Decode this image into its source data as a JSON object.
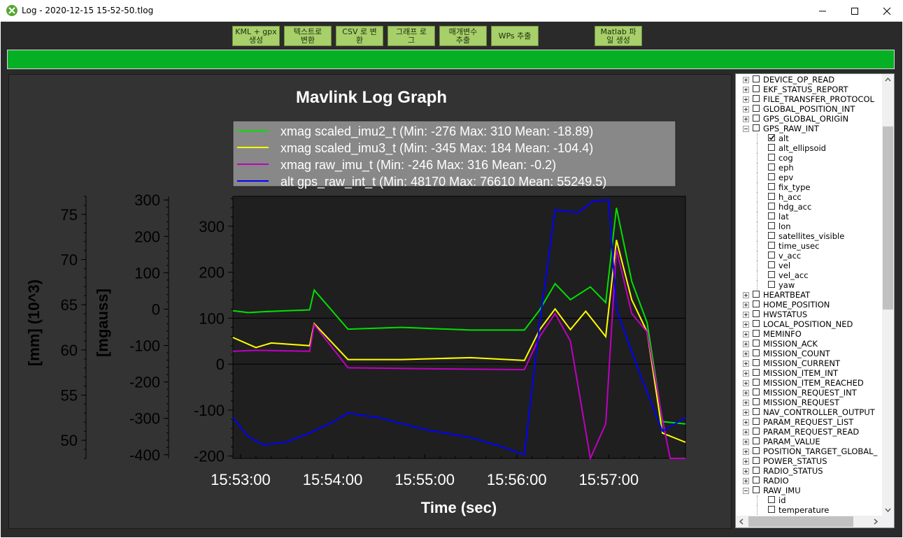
{
  "window": {
    "title": "Log - 2020-12-15 15-52-50.tlog",
    "controls": [
      "minimize-icon",
      "maximize-icon",
      "close-icon"
    ]
  },
  "toolbar": {
    "buttons": [
      {
        "line1": "KML + gpx",
        "line2": "생성"
      },
      {
        "line1": "텍스트로",
        "line2": "변환"
      },
      {
        "line1": "CSV 로 변",
        "line2": "환"
      },
      {
        "line1": "그래프 로",
        "line2": "그"
      },
      {
        "line1": "매개변수",
        "line2": "추출"
      },
      {
        "line1": "WPs 추출",
        "line2": ""
      },
      {
        "line1": "Matlab 파",
        "line2": "일 생성"
      }
    ]
  },
  "progress": {
    "value_percent": 100,
    "color": "#06b025"
  },
  "chart_data": {
    "type": "line",
    "title": "Mavlink Log Graph",
    "xlabel": "Time (sec)",
    "x_ticks": [
      "15:53:00",
      "15:54:00",
      "15:55:00",
      "15:56:00",
      "15:57:00"
    ],
    "x_range": [
      "15:52:55",
      "15:57:50"
    ],
    "y_axes": [
      {
        "label": "[mm] (10^3)",
        "ticks": [
          50,
          55,
          60,
          65,
          70,
          75
        ],
        "range": [
          48,
          77
        ]
      },
      {
        "label": "[mgauss]",
        "ticks": [
          -400,
          -300,
          -200,
          -100,
          0,
          100,
          200,
          300
        ],
        "range": [
          -410,
          310
        ]
      },
      {
        "label": "",
        "ticks": [
          -200,
          -100,
          0,
          100,
          200,
          300
        ],
        "range": [
          -205,
          365
        ]
      }
    ],
    "grid": true,
    "legend_position": "top-center",
    "series": [
      {
        "name": "xmag scaled_imu2_t (Min: -276 Max: 310 Mean: -18.89)",
        "color": "#00e000",
        "x": [
          "15:52:55",
          "15:53:05",
          "15:53:15",
          "15:53:30",
          "15:53:45",
          "15:53:48",
          "15:54:10",
          "15:54:45",
          "15:55:30",
          "15:56:05",
          "15:56:15",
          "15:56:25",
          "15:56:35",
          "15:56:48",
          "15:56:58",
          "15:57:05",
          "15:57:15",
          "15:57:25",
          "15:57:35",
          "15:57:50"
        ],
        "y": [
          116,
          112,
          114,
          116,
          118,
          161,
          76,
          80,
          74,
          74,
          118,
          175,
          140,
          168,
          134,
          340,
          180,
          90,
          -125,
          -130
        ]
      },
      {
        "name": "xmag scaled_imu3_t (Min: -345 Max: 184 Mean: -104.4)",
        "color": "#ffff00",
        "x": [
          "15:52:55",
          "15:53:10",
          "15:53:20",
          "15:53:45",
          "15:53:48",
          "15:54:10",
          "15:54:45",
          "15:55:30",
          "15:56:05",
          "15:56:15",
          "15:56:25",
          "15:56:35",
          "15:56:45",
          "15:56:58",
          "15:57:05",
          "15:57:15",
          "15:57:25",
          "15:57:35",
          "15:57:50"
        ],
        "y": [
          58,
          36,
          46,
          40,
          88,
          10,
          10,
          14,
          8,
          75,
          120,
          75,
          115,
          60,
          270,
          140,
          70,
          -150,
          -170
        ]
      },
      {
        "name": "xmag raw_imu_t (Min: -246 Max: 316 Mean: -0.2)",
        "color": "#c000c0",
        "x": [
          "15:52:55",
          "15:53:10",
          "15:53:45",
          "15:53:48",
          "15:54:10",
          "15:55:00",
          "15:56:05",
          "15:56:15",
          "15:56:25",
          "15:56:35",
          "15:56:48",
          "15:56:58",
          "15:57:05",
          "15:57:15",
          "15:57:25",
          "15:57:35",
          "15:57:40",
          "15:57:50"
        ],
        "y": [
          28,
          30,
          28,
          86,
          -8,
          -10,
          -12,
          60,
          110,
          50,
          -230,
          -130,
          250,
          110,
          70,
          -120,
          -245,
          -246
        ]
      },
      {
        "name": "alt gps_raw_int_t (Min: 48170 Max: 76610 Mean: 55249.5)",
        "color": "#0000ff",
        "x": [
          "15:52:55",
          "15:53:05",
          "15:53:15",
          "15:53:30",
          "15:53:45",
          "15:54:00",
          "15:54:10",
          "15:54:30",
          "15:55:00",
          "15:55:30",
          "15:55:50",
          "15:56:05",
          "15:56:15",
          "15:56:25",
          "15:56:40",
          "15:56:50",
          "15:57:00",
          "15:57:05",
          "15:57:20",
          "15:57:35",
          "15:57:50"
        ],
        "y": [
          52.5,
          50.4,
          49.5,
          49.8,
          50.8,
          52.0,
          53.0,
          52.5,
          51.2,
          50.3,
          49.3,
          48.4,
          63.0,
          75.5,
          75.2,
          76.5,
          76.6,
          64.5,
          57.5,
          51.0,
          52.5
        ]
      }
    ]
  },
  "tree": {
    "items": [
      {
        "label": "DEVICE_OP_READ",
        "level": 0,
        "expand": "+"
      },
      {
        "label": "EKF_STATUS_REPORT",
        "level": 0,
        "expand": "+"
      },
      {
        "label": "FILE_TRANSFER_PROTOCOL",
        "level": 0,
        "expand": "+"
      },
      {
        "label": "GLOBAL_POSITION_INT",
        "level": 0,
        "expand": "+"
      },
      {
        "label": "GPS_GLOBAL_ORIGIN",
        "level": 0,
        "expand": "+"
      },
      {
        "label": "GPS_RAW_INT",
        "level": 0,
        "expand": "-"
      },
      {
        "label": "alt",
        "level": 1,
        "checked": true
      },
      {
        "label": "alt_ellipsoid",
        "level": 1
      },
      {
        "label": "cog",
        "level": 1
      },
      {
        "label": "eph",
        "level": 1
      },
      {
        "label": "epv",
        "level": 1
      },
      {
        "label": "fix_type",
        "level": 1
      },
      {
        "label": "h_acc",
        "level": 1
      },
      {
        "label": "hdg_acc",
        "level": 1
      },
      {
        "label": "lat",
        "level": 1
      },
      {
        "label": "lon",
        "level": 1
      },
      {
        "label": "satellites_visible",
        "level": 1
      },
      {
        "label": "time_usec",
        "level": 1
      },
      {
        "label": "v_acc",
        "level": 1
      },
      {
        "label": "vel",
        "level": 1
      },
      {
        "label": "vel_acc",
        "level": 1
      },
      {
        "label": "yaw",
        "level": 1
      },
      {
        "label": "HEARTBEAT",
        "level": 0,
        "expand": "+"
      },
      {
        "label": "HOME_POSITION",
        "level": 0,
        "expand": "+"
      },
      {
        "label": "HWSTATUS",
        "level": 0,
        "expand": "+"
      },
      {
        "label": "LOCAL_POSITION_NED",
        "level": 0,
        "expand": "+"
      },
      {
        "label": "MEMINFO",
        "level": 0,
        "expand": "+"
      },
      {
        "label": "MISSION_ACK",
        "level": 0,
        "expand": "+"
      },
      {
        "label": "MISSION_COUNT",
        "level": 0,
        "expand": "+"
      },
      {
        "label": "MISSION_CURRENT",
        "level": 0,
        "expand": "+"
      },
      {
        "label": "MISSION_ITEM_INT",
        "level": 0,
        "expand": "+"
      },
      {
        "label": "MISSION_ITEM_REACHED",
        "level": 0,
        "expand": "+"
      },
      {
        "label": "MISSION_REQUEST_INT",
        "level": 0,
        "expand": "+"
      },
      {
        "label": "MISSION_REQUEST",
        "level": 0,
        "expand": "+"
      },
      {
        "label": "NAV_CONTROLLER_OUTPUT",
        "level": 0,
        "expand": "+"
      },
      {
        "label": "PARAM_REQUEST_LIST",
        "level": 0,
        "expand": "+"
      },
      {
        "label": "PARAM_REQUEST_READ",
        "level": 0,
        "expand": "+"
      },
      {
        "label": "PARAM_VALUE",
        "level": 0,
        "expand": "+"
      },
      {
        "label": "POSITION_TARGET_GLOBAL_",
        "level": 0,
        "expand": "+"
      },
      {
        "label": "POWER_STATUS",
        "level": 0,
        "expand": "+"
      },
      {
        "label": "RADIO_STATUS",
        "level": 0,
        "expand": "+"
      },
      {
        "label": "RADIO",
        "level": 0,
        "expand": "+"
      },
      {
        "label": "RAW_IMU",
        "level": 0,
        "expand": "-"
      },
      {
        "label": "id",
        "level": 1
      },
      {
        "label": "temperature",
        "level": 1
      }
    ]
  }
}
